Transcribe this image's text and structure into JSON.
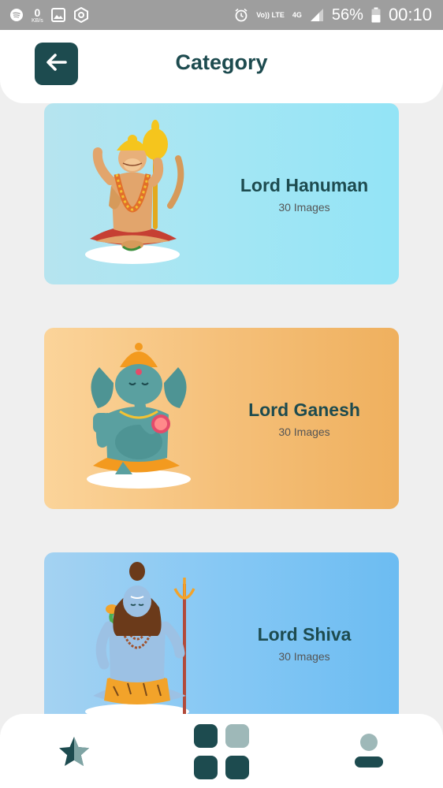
{
  "status_bar": {
    "network_speed_value": "0",
    "network_speed_unit": "KB/s",
    "network_label": "Vo)) LTE",
    "signal_type": "4G",
    "battery_percent": "56%",
    "time": "00:10",
    "icons": [
      "spotify-icon",
      "image-icon",
      "hex-app-icon",
      "alarm-icon",
      "signal-icon",
      "battery-icon"
    ]
  },
  "header": {
    "title": "Category",
    "back_icon": "arrow-left-icon"
  },
  "categories": [
    {
      "title": "Lord Hanuman",
      "count": "30 Images"
    },
    {
      "title": "Lord Ganesh",
      "count": "30 Images"
    },
    {
      "title": "Lord Shiva",
      "count": "30 Images"
    }
  ],
  "bottom_nav": {
    "items": [
      "star-icon",
      "grid-icon",
      "profile-icon"
    ]
  },
  "colors": {
    "accent": "#1d4b4f",
    "background": "#efefef",
    "hanuman_card": "#a4e6f4",
    "ganesh_card": "#f5c07a",
    "shiva_card": "#86c8f4"
  }
}
